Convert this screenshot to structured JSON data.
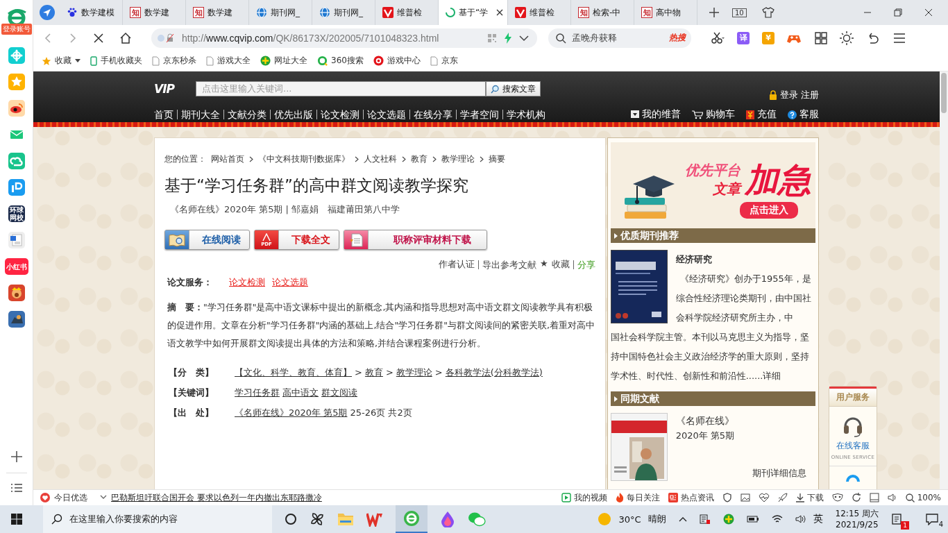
{
  "sidebar": {
    "login_label": "登录账号",
    "school_tile": "环球网校",
    "notes_tile": "小红书"
  },
  "tabs": [
    {
      "title": "数学建模",
      "kind": "paw",
      "selected": false
    },
    {
      "title": "数学建",
      "kind": "text",
      "favicon_text": "知",
      "selected": false
    },
    {
      "title": "数学建",
      "kind": "text",
      "favicon_text": "知",
      "selected": false
    },
    {
      "title": "期刊网_",
      "kind": "globe",
      "selected": false
    },
    {
      "title": "期刊网_",
      "kind": "globe",
      "selected": false
    },
    {
      "title": "维普检",
      "kind": "v",
      "selected": false
    },
    {
      "title": "基于“学",
      "kind": "loading",
      "selected": true
    },
    {
      "title": "维普检",
      "kind": "v",
      "selected": false
    },
    {
      "title": "检索-中",
      "kind": "text",
      "favicon_text": "知",
      "selected": false
    },
    {
      "title": "高中物",
      "kind": "text",
      "favicon_text": "知",
      "selected": false
    }
  ],
  "tab_count": "10",
  "address": {
    "scheme": "http://",
    "host": "www.cqvip.com",
    "path": "/QK/86173X/202005/7101048323.html"
  },
  "search": {
    "value": "孟晚舟获释",
    "hot_label": "热搜"
  },
  "toolbar": {
    "translate": "译",
    "currency": "¥"
  },
  "bookmarks": [
    {
      "label": "收藏",
      "kind": "star"
    },
    {
      "label": "手机收藏夹",
      "kind": "phone"
    },
    {
      "label": "京东秒杀",
      "kind": "page"
    },
    {
      "label": "游戏大全",
      "kind": "page"
    },
    {
      "label": "网址大全",
      "kind": "plus"
    },
    {
      "label": "360搜索",
      "kind": "ring"
    },
    {
      "label": "游戏中心",
      "kind": "game"
    },
    {
      "label": "京东",
      "kind": "page"
    }
  ],
  "site": {
    "logo": "VIP",
    "search_placeholder": "点击这里输入关键词...",
    "search_button": "搜索文章",
    "login": "登录",
    "register": "注册",
    "nav": [
      "首页",
      "期刊大全",
      "文献分类",
      "优先出版",
      "论文检测",
      "论文选题",
      "在线分享",
      "学者空间",
      "学术机构"
    ],
    "user_links": [
      {
        "label": "我的维普",
        "kind": "box"
      },
      {
        "label": "购物车",
        "kind": "cart"
      },
      {
        "label": "充值",
        "kind": "yen"
      },
      {
        "label": "客服",
        "kind": "help"
      }
    ]
  },
  "article": {
    "breadcrumb_prefix": "您的位置：",
    "breadcrumb": [
      "网站首页",
      "《中文科技期刊数据库》",
      "人文社科",
      "教育",
      "教学理论",
      "摘要"
    ],
    "title": "基于“学习任务群”的高中群文阅读教学探究",
    "meta": "《名师在线》2020年 第5期 | 邹嘉娟　福建莆田第八中学",
    "actions": [
      {
        "label": "在线阅读",
        "kind": "read"
      },
      {
        "label": "下载全文",
        "kind": "pdf",
        "icon_text": "PDF"
      },
      {
        "label": "职称评审材料下载",
        "kind": "doc"
      }
    ],
    "tools": [
      {
        "text": "作者认证",
        "kind": "link",
        "divider": false
      },
      {
        "text": "导出参考文献",
        "kind": "link",
        "divider": true
      },
      {
        "text": "★",
        "kind": "star",
        "divider": false
      },
      {
        "text": "收藏",
        "kind": "link",
        "divider": false
      },
      {
        "text": "分享",
        "kind": "share",
        "divider": true
      }
    ],
    "services_label": "论文服务：",
    "services": [
      "论文检测",
      "论文选题"
    ],
    "abstract": "**摘　要：**\"学习任务群\"是高中语文课标中提出的新概念,其内涵和指导思想对高中语文群文阅读教学具有积极的促进作用。文章在分析\"学习任务群\"内涵的基础上,结合\"学习任务群\"与群文阅读间的紧密关联,着重对高中语文教学中如何开展群文阅读提出具体的方法和策略,并结合课程案例进行分析。",
    "fields": [
      {
        "label": "【分　类】",
        "parts": [
          {
            "text": "【文化、科学、教育、体育】",
            "link": true
          },
          {
            "text": ">",
            "link": false
          },
          {
            "text": "教育",
            "link": true
          },
          {
            "text": ">",
            "link": false
          },
          {
            "text": "教学理论",
            "link": true
          },
          {
            "text": ">",
            "link": false
          },
          {
            "text": "各科教学法(分科教学法)",
            "link": true
          }
        ]
      },
      {
        "label": "【关键词】",
        "parts": [
          {
            "text": "学习任务群",
            "link": true
          },
          {
            "text": "高中语文",
            "link": true
          },
          {
            "text": "群文阅读",
            "link": true
          }
        ]
      },
      {
        "label": "【出　处】",
        "parts": [
          {
            "text": "《名师在线》2020年 第5期",
            "link": true
          },
          {
            "text": "25-26页 共2页",
            "link": false
          }
        ]
      }
    ]
  },
  "banner": {
    "line1": "优先平台",
    "line2": "文章",
    "big": "加急",
    "button": "点击进入"
  },
  "recommend": {
    "title": "优质期刊推荐",
    "journal": "经济研究",
    "description": "《经济研究》创办于1955年，是综合性经济理论类期刊，由中国社会科学院经济研究所主办，中",
    "description_continued": "国社会科学院主管。本刊以马克思主义为指导，坚持中国特色社会主义政治经济学的重大原则，坚持学术性、时代性、创新性和前沿性......",
    "more": "详细"
  },
  "same_issue": {
    "title": "同期文献",
    "journal": "《名师在线》",
    "issue": "2020年 第5期",
    "more": "期刊详细信息"
  },
  "service_panel": {
    "title": "用户服务",
    "label": "在线客服",
    "sub": "ONLINE SERVICE"
  },
  "status_bar": {
    "today": "今日优选",
    "headline": "巴勒斯坦吁联合国开会 要求以色列一年内撤出东耶路撒冷",
    "items": [
      {
        "label": "我的视频",
        "kind": "video"
      },
      {
        "label": "每日关注",
        "kind": "fire"
      },
      {
        "label": "热点资讯",
        "kind": "news"
      }
    ],
    "download": "下载",
    "zoom": "100%"
  },
  "taskbar": {
    "search_placeholder": "在这里输入你要搜索的内容",
    "temperature": "30°C",
    "weather": "晴朗",
    "ime": "英",
    "time": "12:15 周六",
    "date": "2021/9/25",
    "notification_badge": "1",
    "messages": "4"
  }
}
